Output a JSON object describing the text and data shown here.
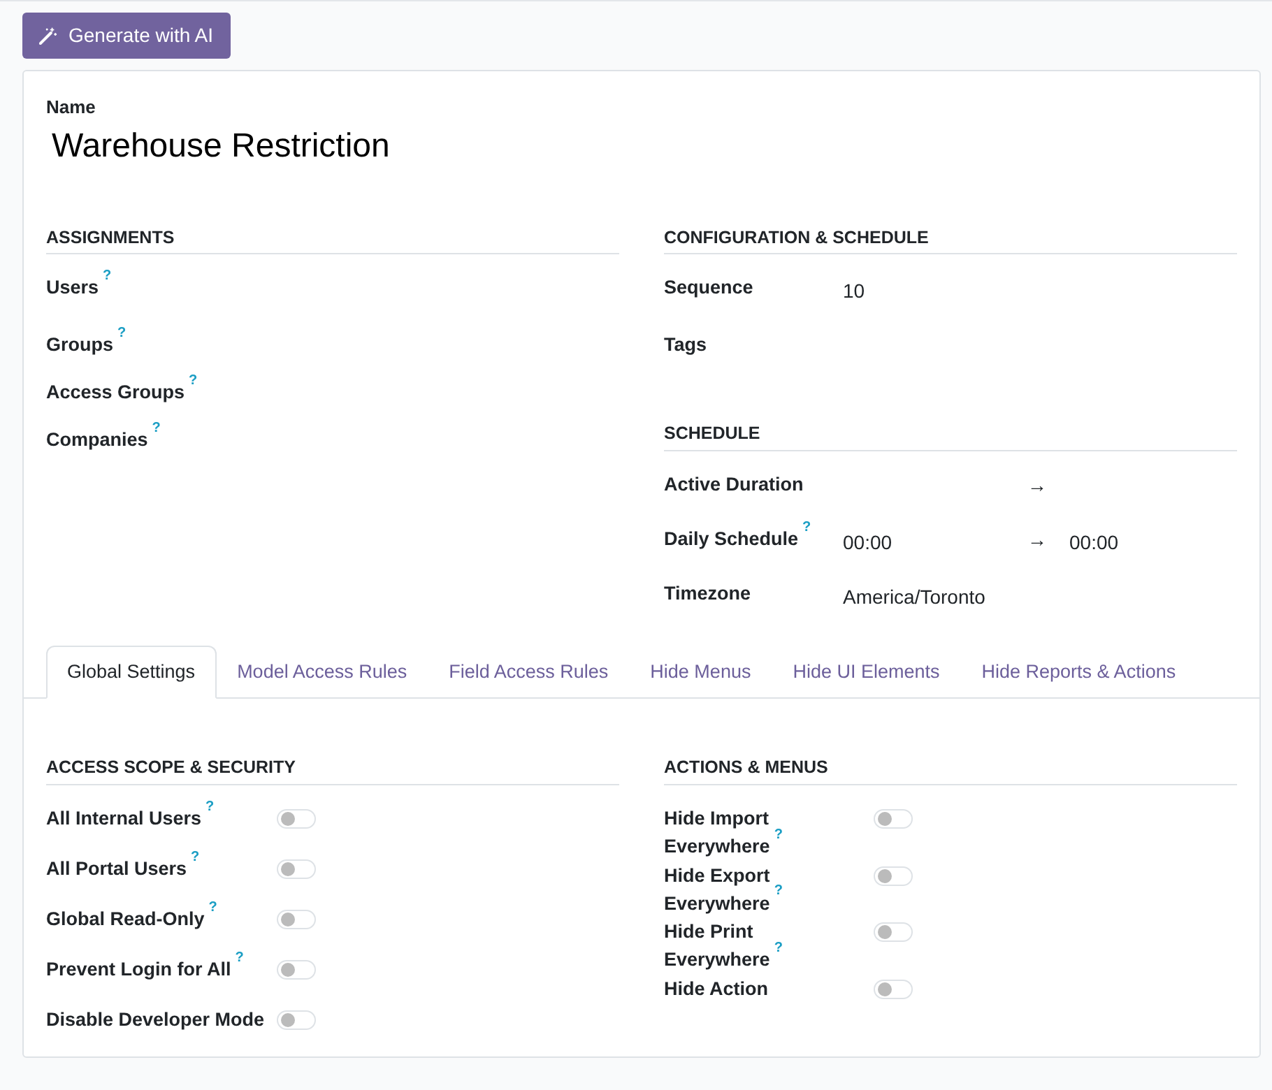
{
  "toolbar": {
    "button": {
      "label": "Generate with AI"
    }
  },
  "name_field": {
    "label": "Name",
    "value": "Warehouse Restriction"
  },
  "top_groups": [
    {
      "title": "ASSIGNMENTS",
      "fields": [
        {
          "label": "Users",
          "help": "?",
          "kind": "empty"
        },
        {
          "label": "Groups",
          "help": "?",
          "kind": "empty"
        },
        {
          "label": "Access Groups",
          "help": "?",
          "kind": "empty"
        },
        {
          "label": "Companies",
          "help": "?",
          "kind": "empty"
        }
      ]
    },
    {
      "title": "CONFIGURATION & SCHEDULE",
      "fields": [
        {
          "label": "Sequence",
          "kind": "value",
          "value": "10"
        },
        {
          "label": "Tags",
          "kind": "empty"
        }
      ]
    },
    {
      "title": "SCHEDULE",
      "fields": [
        {
          "label": "Active Duration",
          "kind": "range",
          "arrow": "→"
        },
        {
          "label": "Daily Schedule",
          "help": "?",
          "kind": "range",
          "start": "00:00",
          "arrow": "→",
          "end": "00:00"
        },
        {
          "label": "Timezone",
          "kind": "value",
          "value": "America/Toronto"
        }
      ]
    }
  ],
  "tabs": [
    {
      "label": "Global Settings",
      "selected": true
    },
    {
      "label": "Model Access Rules",
      "selected": false
    },
    {
      "label": "Field Access Rules",
      "selected": false
    },
    {
      "label": "Hide Menus",
      "selected": false
    },
    {
      "label": "Hide UI Elements",
      "selected": false
    },
    {
      "label": "Hide Reports & Actions",
      "selected": false
    }
  ],
  "tab_groups": [
    {
      "title": "ACCESS SCOPE & SECURITY",
      "fields": [
        {
          "label": "All Internal Users",
          "help": "?",
          "checked": false
        },
        {
          "label": "All Portal Users",
          "help": "?",
          "checked": false
        },
        {
          "label": "Global Read-Only",
          "help": "?",
          "checked": false
        },
        {
          "label": "Prevent Login for All",
          "help": "?",
          "checked": false
        },
        {
          "label": "Disable Developer Mode",
          "checked": false
        }
      ]
    },
    {
      "title": "ACTIONS & MENUS",
      "fields": [
        {
          "label": "Hide Import Everywhere",
          "help": "?",
          "checked": false
        },
        {
          "label": "Hide Export Everywhere",
          "help": "?",
          "checked": false
        },
        {
          "label": "Hide Print Everywhere",
          "help": "?",
          "checked": false
        },
        {
          "label": "Hide Action",
          "checked": false
        }
      ]
    }
  ]
}
